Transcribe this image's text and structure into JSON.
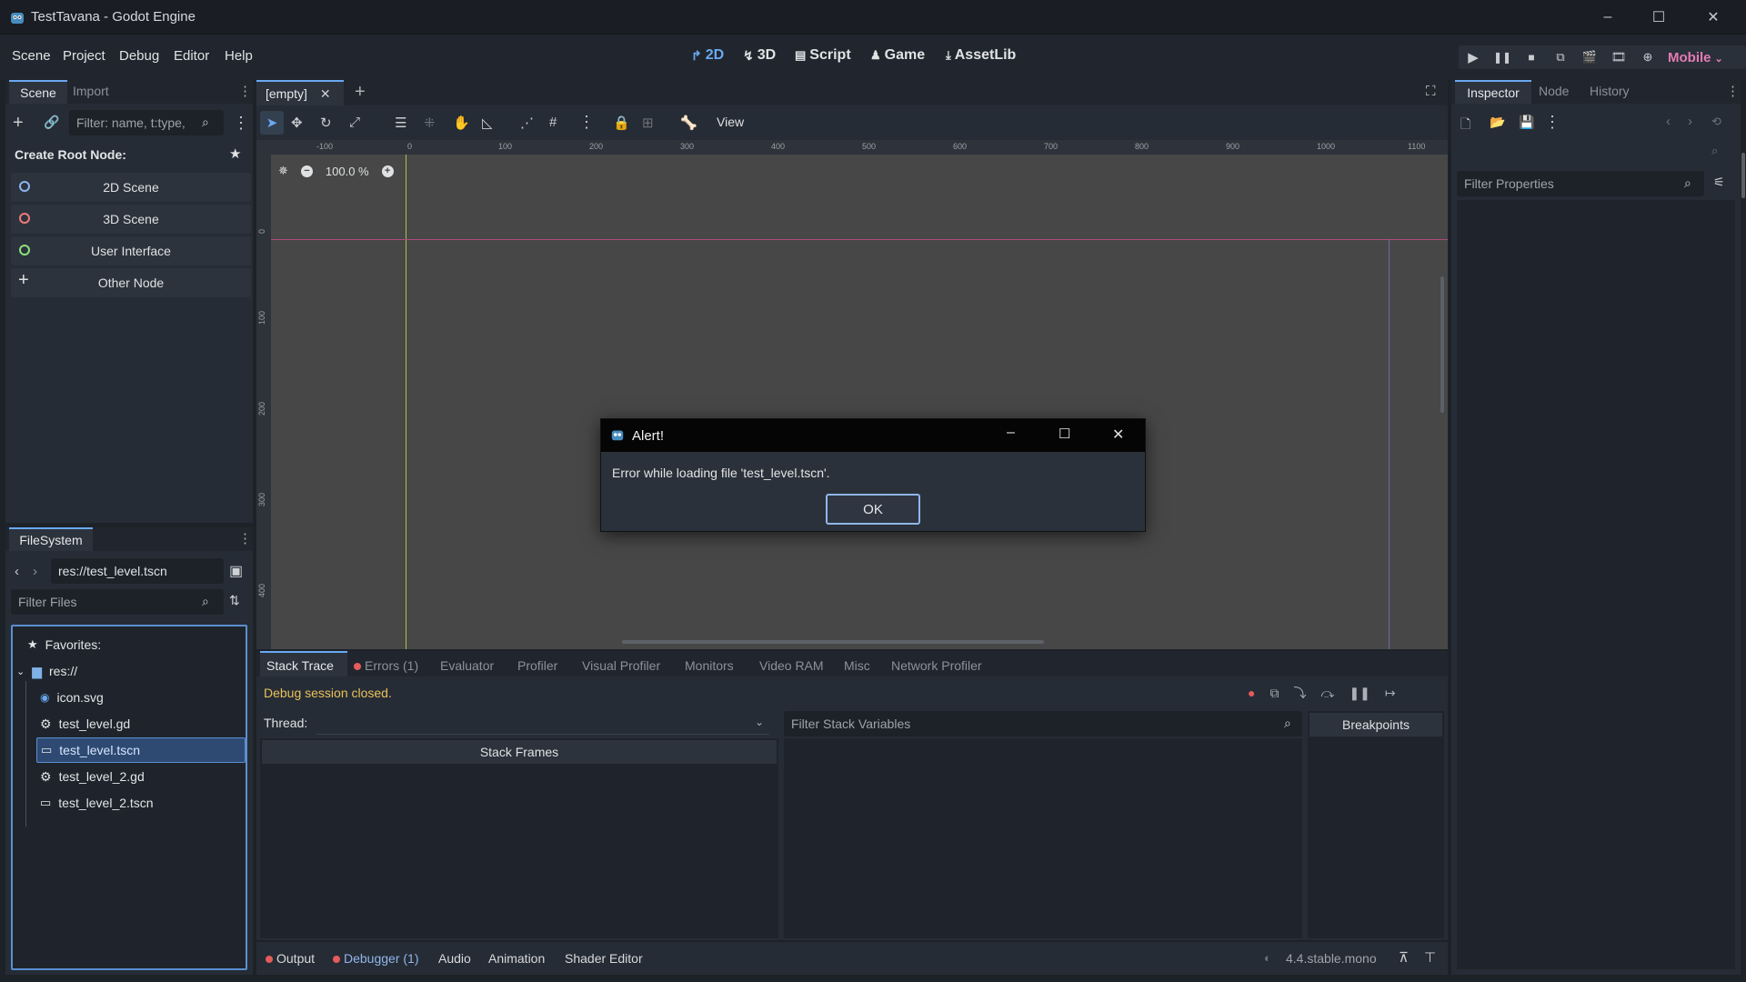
{
  "window": {
    "title": "TestTavana - Godot Engine"
  },
  "menu": {
    "items": [
      "Scene",
      "Project",
      "Debug",
      "Editor",
      "Help"
    ]
  },
  "workspaces": [
    {
      "label": "2D",
      "icon": "2d-icon",
      "active": true
    },
    {
      "label": "3D",
      "icon": "3d-icon",
      "active": false
    },
    {
      "label": "Script",
      "icon": "script-icon",
      "active": false
    },
    {
      "label": "Game",
      "icon": "game-icon",
      "active": false
    },
    {
      "label": "AssetLib",
      "icon": "assetlib-icon",
      "active": false
    }
  ],
  "renderer": {
    "label": "Mobile",
    "color": "#e57ab5"
  },
  "scene_dock": {
    "tabs": [
      "Scene",
      "Import"
    ],
    "filter_placeholder": "Filter: name, t:type,",
    "create_root_label": "Create Root Node:",
    "root_nodes": [
      {
        "label": "2D Scene",
        "icon": "node2d-icon",
        "color": "#8db4f0"
      },
      {
        "label": "3D Scene",
        "icon": "node3d-icon",
        "color": "#f07b7b"
      },
      {
        "label": "User Interface",
        "icon": "control-icon",
        "color": "#8ee07b"
      },
      {
        "label": "Other Node",
        "icon": "plus-icon",
        "color": "#dfe1e3"
      }
    ]
  },
  "filesystem_dock": {
    "tab": "FileSystem",
    "path": "res://test_level.tscn",
    "filter_placeholder": "Filter Files",
    "favorites_label": "Favorites:",
    "root_label": "res://",
    "files": [
      {
        "name": "icon.svg",
        "icon": "godot-icon",
        "selected": false
      },
      {
        "name": "test_level.gd",
        "icon": "gear-icon",
        "selected": false
      },
      {
        "name": "test_level.tscn",
        "icon": "scene-icon",
        "selected": true
      },
      {
        "name": "test_level_2.gd",
        "icon": "gear-icon",
        "selected": false
      },
      {
        "name": "test_level_2.tscn",
        "icon": "scene-icon",
        "selected": false
      }
    ]
  },
  "editor_tabs": {
    "active": "[empty]"
  },
  "toolbar": {
    "view_label": "View"
  },
  "viewport": {
    "zoom": "100.0 %",
    "ruler_x": [
      "-100",
      "0",
      "100",
      "200",
      "300",
      "400",
      "500",
      "600",
      "700",
      "800",
      "900",
      "1000",
      "1100"
    ],
    "ruler_y": [
      "0",
      "100",
      "200",
      "300",
      "400"
    ]
  },
  "alert": {
    "title": "Alert!",
    "message": "Error while loading file 'test_level.tscn'.",
    "ok_label": "OK"
  },
  "debugger": {
    "tabs": [
      "Stack Trace",
      "Errors (1)",
      "Evaluator",
      "Profiler",
      "Visual Profiler",
      "Monitors",
      "Video RAM",
      "Misc",
      "Network Profiler"
    ],
    "status": "Debug session closed.",
    "status_color": "#e8c15a",
    "thread_label": "Thread:",
    "filter_vars_placeholder": "Filter Stack Variables",
    "stack_frames_label": "Stack Frames",
    "breakpoints_label": "Breakpoints"
  },
  "bottom_bar": {
    "tabs": [
      "Output",
      "Debugger (1)",
      "Audio",
      "Animation",
      "Shader Editor"
    ],
    "version": "4.4.stable.mono"
  },
  "inspector": {
    "tabs": [
      "Inspector",
      "Node",
      "History"
    ],
    "filter_placeholder": "Filter Properties"
  }
}
